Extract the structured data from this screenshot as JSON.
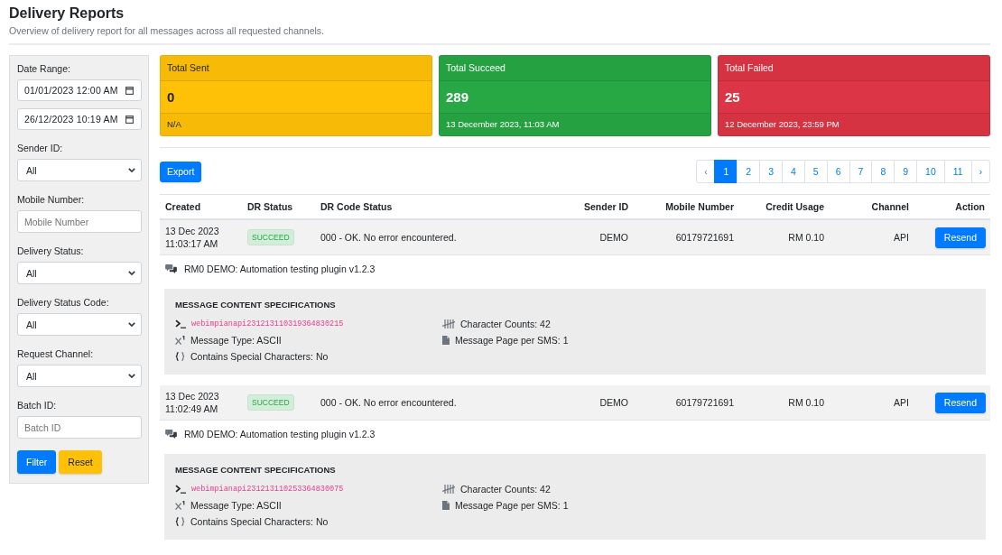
{
  "header": {
    "title": "Delivery Reports",
    "subtitle": "Overview of delivery report for all messages across all requested channels."
  },
  "filters": {
    "fields": [
      {
        "kind": "datetime_range",
        "label": "Date Range:",
        "values": [
          "01/01/2023 12:00 AM",
          "26/12/2023 10:19 AM"
        ]
      },
      {
        "kind": "select",
        "label": "Sender ID:",
        "value": "All"
      },
      {
        "kind": "text",
        "label": "Mobile Number:",
        "placeholder": "Mobile Number"
      },
      {
        "kind": "select",
        "label": "Delivery Status:",
        "value": "All"
      },
      {
        "kind": "select",
        "label": "Delivery Status Code:",
        "value": "All"
      },
      {
        "kind": "select",
        "label": "Request Channel:",
        "value": "All"
      },
      {
        "kind": "text",
        "label": "Batch ID:",
        "placeholder": "Batch ID"
      }
    ],
    "buttons": [
      {
        "kind": "filter",
        "label": "Filter"
      },
      {
        "kind": "reset",
        "label": "Reset"
      }
    ]
  },
  "summary_cards": [
    {
      "title": "Total Sent",
      "value": "0",
      "footer": "N/A",
      "color": "#ffc107"
    },
    {
      "title": "Total Succeed",
      "value": "289",
      "footer": "13 December 2023, 11:03 AM",
      "color": "#28a745"
    },
    {
      "title": "Total Failed",
      "value": "25",
      "footer": "12 December 2023, 23:59 PM",
      "color": "#dc3545"
    }
  ],
  "toolbar": {
    "export_button": "Export"
  },
  "pagination": [
    {
      "kind": "prev",
      "label": "‹",
      "selected": false,
      "disabled": true
    },
    {
      "kind": "page",
      "label": "1",
      "selected": true,
      "disabled": false
    },
    {
      "kind": "page",
      "label": "2",
      "selected": false,
      "disabled": false
    },
    {
      "kind": "page",
      "label": "3",
      "selected": false,
      "disabled": false
    },
    {
      "kind": "page",
      "label": "4",
      "selected": false,
      "disabled": false
    },
    {
      "kind": "page",
      "label": "5",
      "selected": false,
      "disabled": false
    },
    {
      "kind": "page",
      "label": "6",
      "selected": false,
      "disabled": false
    },
    {
      "kind": "page",
      "label": "7",
      "selected": false,
      "disabled": false
    },
    {
      "kind": "page",
      "label": "8",
      "selected": false,
      "disabled": false
    },
    {
      "kind": "page",
      "label": "9",
      "selected": false,
      "disabled": false
    },
    {
      "kind": "page",
      "label": "10",
      "selected": false,
      "disabled": false
    },
    {
      "kind": "page",
      "label": "11",
      "selected": false,
      "disabled": false
    },
    {
      "kind": "next",
      "label": "›",
      "selected": false,
      "disabled": false
    }
  ],
  "table": {
    "columns": [
      "Created",
      "DR Status",
      "DR Code Status",
      "Sender ID",
      "Mobile Number",
      "Credit Usage",
      "Channel",
      "Action"
    ],
    "rows": [
      {
        "created": "13 Dec 2023 11:03:17 AM",
        "dr_status": "SUCCEED",
        "dr_code_status": "000 - OK. No error encountered.",
        "sender_id": "DEMO",
        "mobile_number": "60179721691",
        "credit_usage": "RM 0.10",
        "channel": "API",
        "action": "Resend",
        "message": "RM0 DEMO: Automation testing plugin v1.2.3",
        "specifications": {
          "title": "MESSAGE CONTENT SPECIFICATIONS",
          "reference": "webimpianapi231213110319364830215",
          "message_type": "Message Type: ASCII",
          "special_characters": "Contains Special Characters: No",
          "character_counts": "Character Counts: 42",
          "pages_per_sms": "Message Page per SMS: 1"
        }
      },
      {
        "created": "13 Dec 2023 11:02:49 AM",
        "dr_status": "SUCCEED",
        "dr_code_status": "000 - OK. No error encountered.",
        "sender_id": "DEMO",
        "mobile_number": "60179721691",
        "credit_usage": "RM 0.10",
        "channel": "API",
        "action": "Resend",
        "message": "RM0 DEMO: Automation testing plugin v1.2.3",
        "specifications": {
          "title": "MESSAGE CONTENT SPECIFICATIONS",
          "reference": "webimpianapi231213110253364830075",
          "message_type": "Message Type: ASCII",
          "special_characters": "Contains Special Characters: No",
          "character_counts": "Character Counts: 42",
          "pages_per_sms": "Message Page per SMS: 1"
        }
      }
    ]
  }
}
